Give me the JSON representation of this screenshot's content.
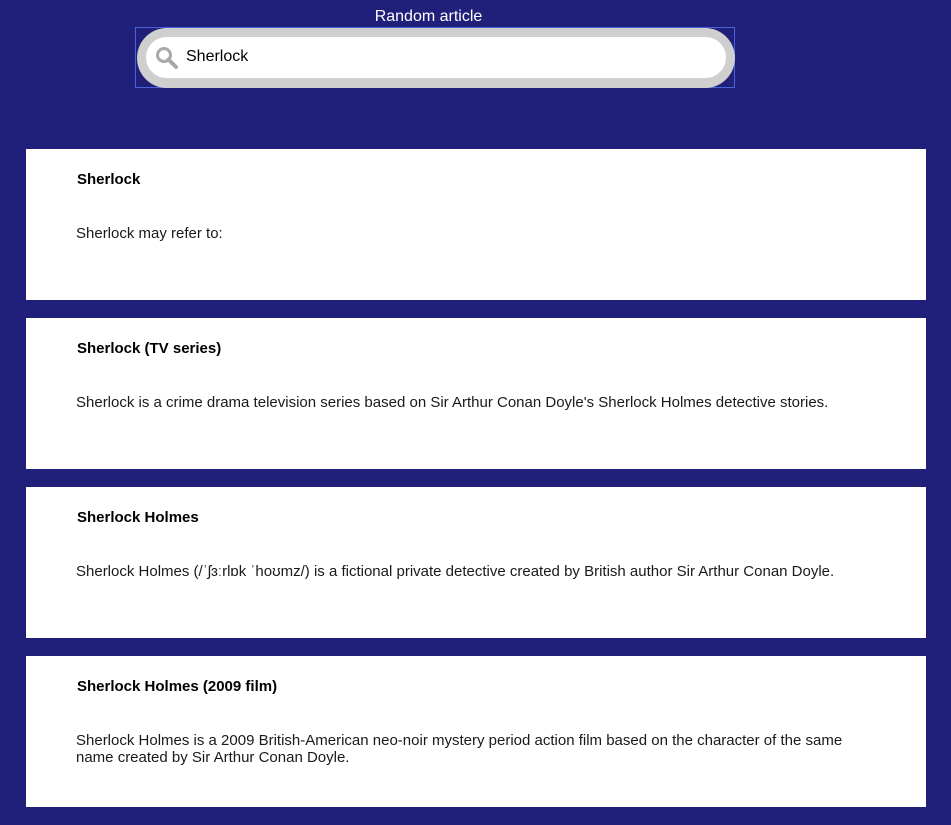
{
  "header": {
    "random_label": "Random article"
  },
  "search": {
    "value": "Sherlock",
    "icon": "search-icon"
  },
  "colors": {
    "background": "#201f7a",
    "search_border": "#cfcfcf",
    "focus_outline": "#4a62d8",
    "card": "#ffffff"
  },
  "results": [
    {
      "title": "Sherlock",
      "snippet": "Sherlock may refer to:"
    },
    {
      "title": "Sherlock (TV series)",
      "snippet": "Sherlock is a crime drama television series based on Sir Arthur Conan Doyle's Sherlock Holmes detective stories."
    },
    {
      "title": "Sherlock Holmes",
      "snippet": "Sherlock Holmes (/ˈʃɜːrlɒk ˈhoʊmz/) is a fictional private detective created by British author Sir Arthur Conan Doyle."
    },
    {
      "title": "Sherlock Holmes (2009 film)",
      "snippet": "Sherlock Holmes is a 2009 British-American neo-noir mystery period action film based on the character of the same name created by Sir Arthur Conan Doyle."
    }
  ]
}
